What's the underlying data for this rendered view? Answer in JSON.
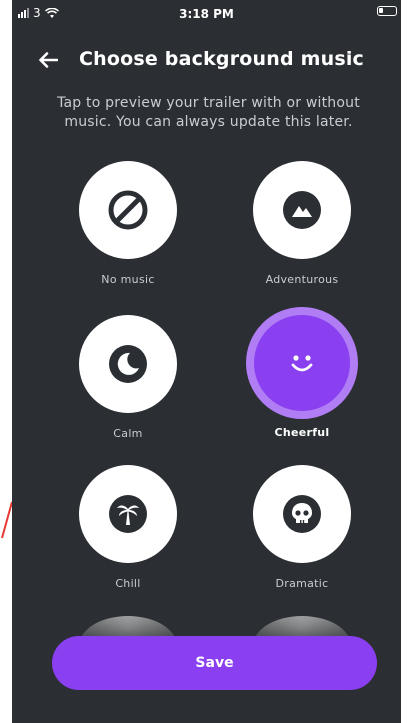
{
  "status_bar": {
    "carrier": "3",
    "time": "3:18 PM"
  },
  "header": {
    "back_icon": "arrow-left-icon",
    "title": "Choose background music"
  },
  "subtitle": "Tap to preview your trailer with or without music. You can always update this later.",
  "options": [
    {
      "label": "No music",
      "icon": "ban-icon",
      "selected": false
    },
    {
      "label": "Adventurous",
      "icon": "mountain-icon",
      "selected": false
    },
    {
      "label": "Calm",
      "icon": "moon-icon",
      "selected": false
    },
    {
      "label": "Cheerful",
      "icon": "smiley-icon",
      "selected": true
    },
    {
      "label": "Chill",
      "icon": "palm-tree-icon",
      "selected": false
    },
    {
      "label": "Dramatic",
      "icon": "skull-icon",
      "selected": false
    }
  ],
  "save_label": "Save",
  "colors": {
    "background": "#2b2f33",
    "accent": "#8a3ff0",
    "accent_ring": "#b07df5"
  }
}
